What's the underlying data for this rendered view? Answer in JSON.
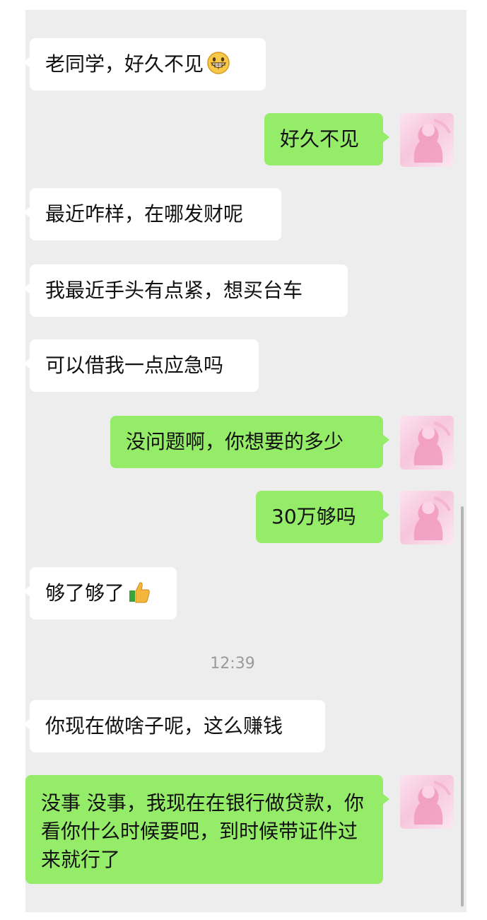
{
  "messages": [
    {
      "side": "in",
      "text": "老同学，好久不见",
      "emoji": "grinning-face-icon"
    },
    {
      "side": "out",
      "text": "好久不见"
    },
    {
      "side": "in",
      "text": "最近咋样，在哪发财呢"
    },
    {
      "side": "in",
      "text": "我最近手头有点紧，想买台车"
    },
    {
      "side": "in",
      "text": "可以借我一点应急吗"
    },
    {
      "side": "out",
      "text": "没问题啊，你想要的多少"
    },
    {
      "side": "out",
      "text": "30万够吗"
    },
    {
      "side": "in",
      "text": "够了够了",
      "emoji": "thumbs-up-icon"
    },
    {
      "side": "in",
      "text": "你现在做啥子呢，这么赚钱"
    },
    {
      "side": "out",
      "text": "没事 没事，我现在在银行做贷款，你看你什么时候要吧，到时候带证件过来就行了"
    }
  ],
  "timestamp": "12:39",
  "colors": {
    "background": "#ededed",
    "incoming_bubble": "#ffffff",
    "outgoing_bubble": "#95ec69",
    "timestamp_text": "#9a9a9a"
  },
  "icons": {
    "avatar": "pink-silhouette-avatar",
    "emoji_1": "grinning-face-icon",
    "emoji_2": "thumbs-up-icon"
  }
}
